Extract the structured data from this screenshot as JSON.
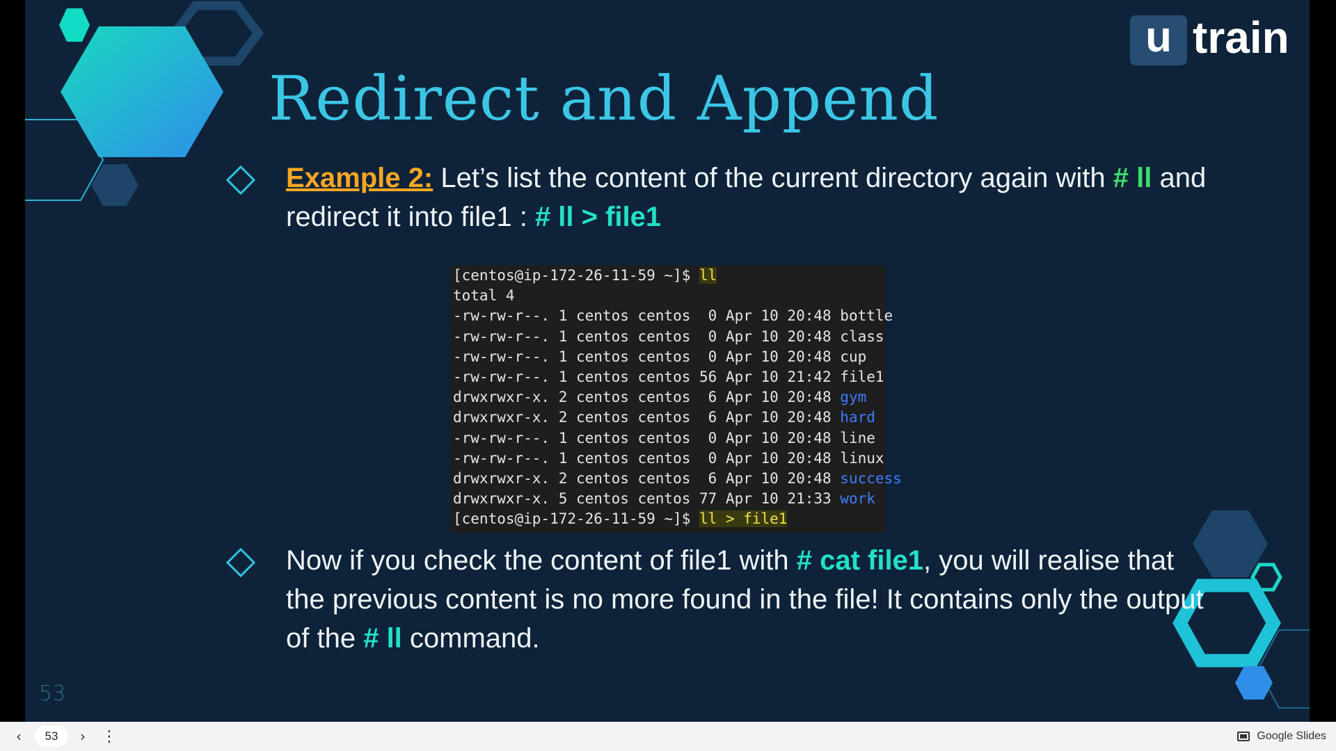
{
  "slide": {
    "title": "Redirect and Append",
    "logo": {
      "u": "u",
      "word": "train"
    },
    "bullet1": {
      "label": "Example 2:",
      "text1": " Let’s list the content of the current directory again with ",
      "cmd1": "# ll",
      "text2": " and redirect it into file1 : ",
      "cmd2": "# ll > file1"
    },
    "terminal": {
      "prompt": "[centos@ip-172-26-11-59 ~]$ ",
      "cmd_first": "ll",
      "total": "total 4",
      "rows": [
        {
          "prefix": "-rw-rw-r--. 1 centos centos  0 Apr 10 20:48 ",
          "name": "bottle",
          "dir": false
        },
        {
          "prefix": "-rw-rw-r--. 1 centos centos  0 Apr 10 20:48 ",
          "name": "class",
          "dir": false
        },
        {
          "prefix": "-rw-rw-r--. 1 centos centos  0 Apr 10 20:48 ",
          "name": "cup",
          "dir": false
        },
        {
          "prefix": "-rw-rw-r--. 1 centos centos 56 Apr 10 21:42 ",
          "name": "file1",
          "dir": false
        },
        {
          "prefix": "drwxrwxr-x. 2 centos centos  6 Apr 10 20:48 ",
          "name": "gym",
          "dir": true
        },
        {
          "prefix": "drwxrwxr-x. 2 centos centos  6 Apr 10 20:48 ",
          "name": "hard",
          "dir": true
        },
        {
          "prefix": "-rw-rw-r--. 1 centos centos  0 Apr 10 20:48 ",
          "name": "line",
          "dir": false
        },
        {
          "prefix": "-rw-rw-r--. 1 centos centos  0 Apr 10 20:48 ",
          "name": "linux",
          "dir": false
        },
        {
          "prefix": "drwxrwxr-x. 2 centos centos  6 Apr 10 20:48 ",
          "name": "success",
          "dir": true
        },
        {
          "prefix": "drwxrwxr-x. 5 centos centos 77 Apr 10 21:33 ",
          "name": "work",
          "dir": true
        }
      ],
      "cmd_last": "ll > file1"
    },
    "bullet2": {
      "text1": "Now if you check the content of file1 with ",
      "cmd1": "# cat file1",
      "text2": ", you will realise that the previous content is no more found in the file! It contains only the output of the ",
      "cmd2": "# ll",
      "text3": " command."
    },
    "slide_number": "53",
    "colors": {
      "background": "#0e2339",
      "title": "#3cc6e6",
      "accent_orange": "#f5a623",
      "cmd_green": "#3ede6a",
      "cmd_teal": "#24e0c8",
      "dir_blue": "#3e7cff"
    }
  },
  "presenter_bar": {
    "prev_icon": "chevron-left-icon",
    "page": "53",
    "next_icon": "chevron-right-icon",
    "more_icon": "more-vert-icon",
    "app_icon": "slides-icon",
    "app_label": "Google Slides"
  }
}
